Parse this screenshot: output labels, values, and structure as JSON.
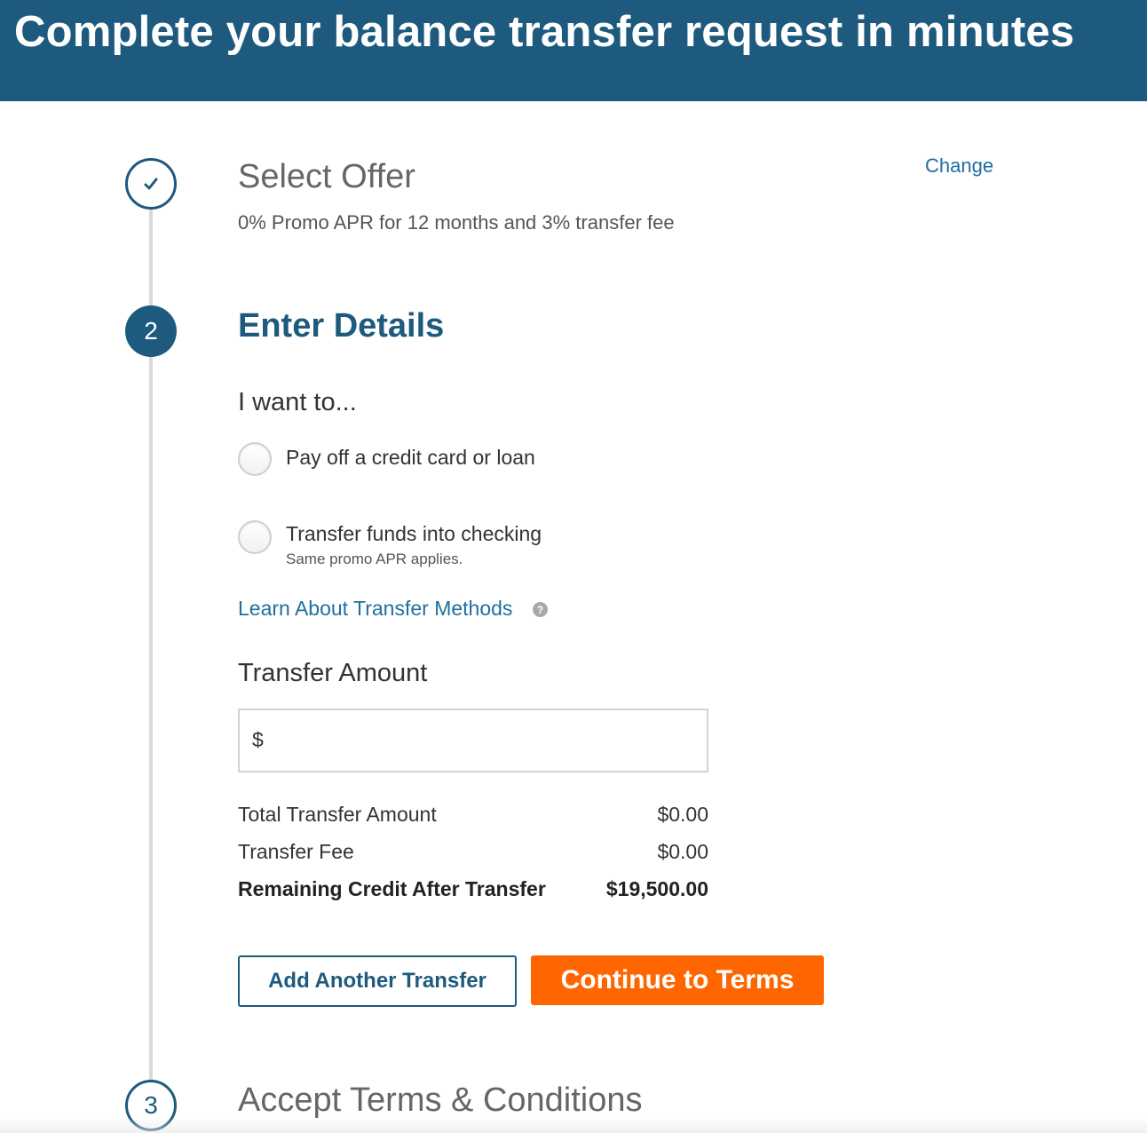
{
  "banner": {
    "title": "Complete your balance transfer request in minutes"
  },
  "steps": {
    "step1": {
      "icon": "checkmark-icon",
      "title": "Select Offer",
      "subtitle": "0% Promo APR for 12 months and 3% transfer fee",
      "change_label": "Change"
    },
    "step2": {
      "number": "2",
      "title": "Enter Details",
      "want_label": "I want to...",
      "options": [
        {
          "label": "Pay off a credit card or loan",
          "sublabel": "",
          "selected": false
        },
        {
          "label": "Transfer funds into checking",
          "sublabel": "Same promo APR applies.",
          "selected": false
        }
      ],
      "learn_link": "Learn About Transfer Methods",
      "help_icon": "question-icon",
      "help_glyph": "?",
      "amount_label": "Transfer Amount",
      "currency_symbol": "$",
      "amount_value": "",
      "summary": [
        {
          "label": "Total Transfer Amount",
          "value": "$0.00"
        },
        {
          "label": "Transfer Fee",
          "value": "$0.00"
        },
        {
          "label": "Remaining Credit After Transfer",
          "value": "$19,500.00"
        }
      ],
      "add_button": "Add Another Transfer",
      "continue_button": "Continue to Terms"
    },
    "step3": {
      "number": "3",
      "title": "Accept Terms & Conditions"
    }
  },
  "colors": {
    "brand": "#1d5a7e",
    "link": "#1f6fa0",
    "cta": "#ff6600"
  }
}
